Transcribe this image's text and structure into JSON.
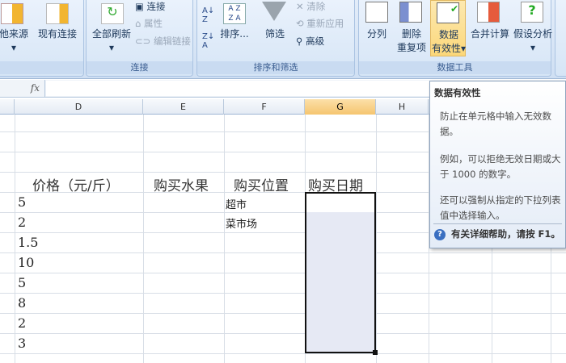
{
  "ribbon": {
    "external": {
      "other_sources": "他来源",
      "existing": "现有连接"
    },
    "connections": {
      "label": "连接",
      "refresh_all": "全部刷新",
      "connections": "连接",
      "properties": "属性",
      "edit_links": "编辑链接"
    },
    "sort_filter": {
      "label": "排序和筛选",
      "sort": "排序...",
      "filter": "筛选",
      "clear": "清除",
      "reapply": "重新应用",
      "advanced": "高级"
    },
    "data_tools": {
      "label": "数据工具",
      "text_to_columns": "分列",
      "remove_dup_1": "删除",
      "remove_dup_2": "重复项",
      "validation_1": "数据",
      "validation_2": "有效性",
      "consolidate": "合并计算",
      "what_if": "假设分析"
    }
  },
  "formula_bar": {
    "fx": "fx",
    "value": ""
  },
  "columns": [
    "D",
    "E",
    "F",
    "G",
    "H"
  ],
  "headers": [
    "价格（元/斤）",
    "购买水果",
    "购买位置",
    "购买日期"
  ],
  "prices": [
    "5",
    "2",
    "1.5",
    "10",
    "5",
    "8",
    "2",
    "3"
  ],
  "locations": [
    "超市",
    "菜市场"
  ],
  "tooltip": {
    "title": "数据有效性",
    "p1": "防止在单元格中输入无效数据。",
    "p2": "例如，可以拒绝无效日期或大于 1000 的数字。",
    "p3": "还可以强制从指定的下拉列表值中选择输入。",
    "help": "有关详细帮助，请按 F1。"
  }
}
